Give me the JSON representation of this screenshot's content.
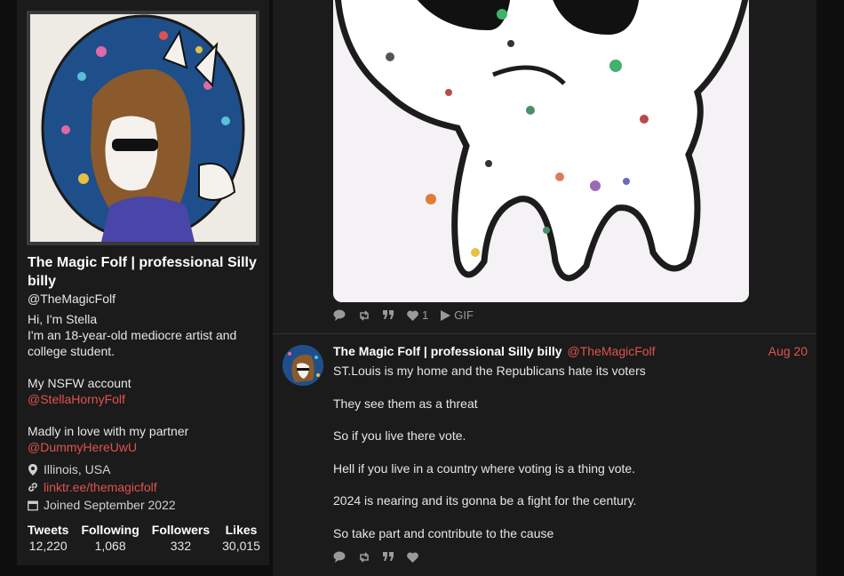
{
  "profile": {
    "name": "The Magic Folf | professional Silly billy",
    "handle": "@TheMagicFolf",
    "bio_lines": [
      "Hi, I'm Stella",
      "I'm an 18-year-old mediocre artist and college student.",
      "My NSFW account",
      "@StellaHornyFolf",
      "Madly in love with my partner",
      "@DummyHereUwU"
    ],
    "location": "Illinois, USA",
    "website": "linktr.ee/themagicfolf",
    "joined": "Joined September 2022",
    "stats": [
      {
        "label": "Tweets",
        "value": "12,220"
      },
      {
        "label": "Following",
        "value": "1,068"
      },
      {
        "label": "Followers",
        "value": "332"
      },
      {
        "label": "Likes",
        "value": "30,015"
      }
    ]
  },
  "media_post": {
    "actions": {
      "like_count": "1",
      "gif_label": "GIF"
    }
  },
  "tweet": {
    "author": "The Magic Folf | professional Silly billy",
    "handle": "@TheMagicFolf",
    "date": "Aug 20",
    "lines": [
      "ST.Louis is my home and the Republicans hate its voters",
      "They see them as a threat",
      "So if you live there vote.",
      "Hell if you live in a country where voting is a thing vote.",
      "2024 is nearing and its gonna be a fight for the century.",
      "So take part and contribute to the cause"
    ]
  },
  "colors": {
    "accent": "#e0524f",
    "panel": "#1b1b1b",
    "background": "#0e0e0e"
  },
  "icons": [
    "location-icon",
    "link-icon",
    "calendar-icon",
    "reply-icon",
    "retweet-icon",
    "quote-icon",
    "like-icon",
    "play-icon"
  ]
}
